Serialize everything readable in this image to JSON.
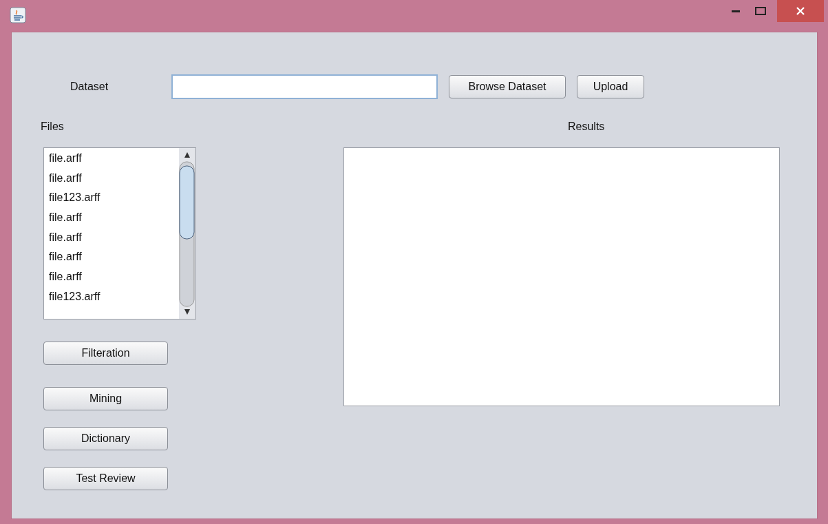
{
  "window": {
    "title_bar": {
      "controls": [
        {
          "kind": "minimize"
        },
        {
          "kind": "maximize"
        },
        {
          "kind": "close"
        }
      ]
    }
  },
  "dataset": {
    "label": "Dataset",
    "buttons": [
      "Browse Dataset",
      "Upload"
    ]
  },
  "files": {
    "label": "Files",
    "items": [
      {
        "name": "file.arff"
      },
      {
        "name": "file.arff"
      },
      {
        "name": "file123.arff"
      },
      {
        "name": "file.arff"
      },
      {
        "name": "file.arff"
      },
      {
        "name": "file.arff"
      },
      {
        "name": "file.arff"
      },
      {
        "name": "file123.arff"
      }
    ]
  },
  "actions": [
    "Filteration",
    "Mining",
    "Dictionary",
    "Test Review"
  ],
  "results": {
    "label": "Results"
  }
}
